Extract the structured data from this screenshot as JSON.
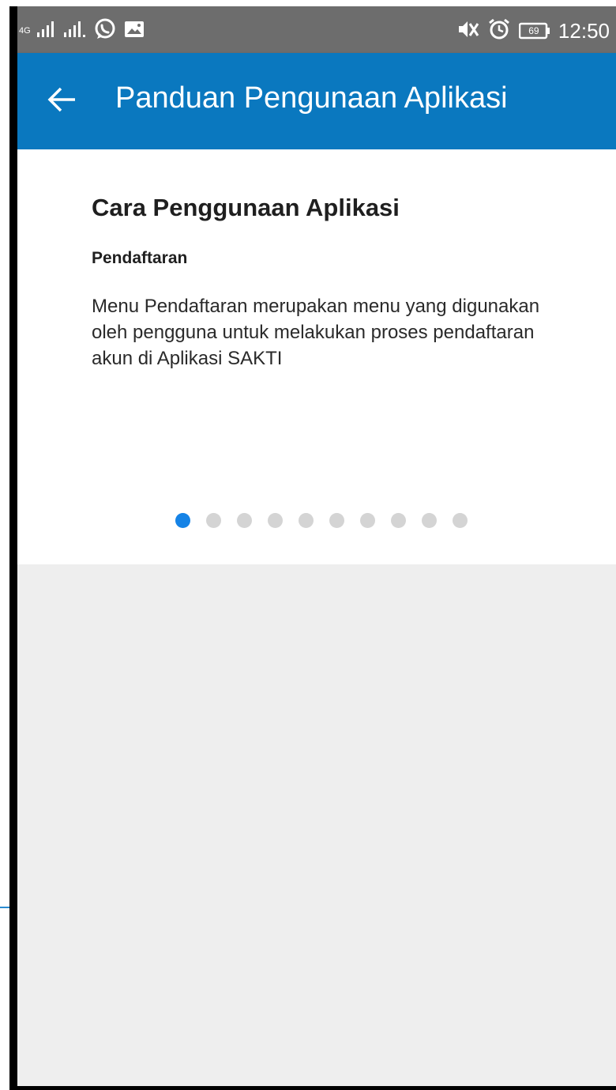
{
  "status_bar": {
    "network_label": "4G",
    "time": "12:50",
    "battery_level": "69",
    "icons": [
      "signal-icon",
      "signal-icon",
      "whatsapp-icon",
      "image-icon",
      "mute-icon",
      "alarm-icon",
      "battery-icon"
    ]
  },
  "app_bar": {
    "back_icon": "arrow-left-icon",
    "title": "Panduan Pengunaan Aplikasi"
  },
  "guide": {
    "title": "Cara Penggunaan Aplikasi",
    "section_heading": "Pendaftaran",
    "section_body": "Menu Pendaftaran merupakan menu yang digunakan oleh pengguna untuk melakukan proses pendaftaran akun di Aplikasi SAKTI"
  },
  "pager": {
    "total_pages": 10,
    "current_page": 1
  },
  "colors": {
    "app_bar": "#0a78bf",
    "status_bar": "#6d6d6d",
    "active_dot": "#1583e6",
    "inactive_dot": "#d4d4d4",
    "background": "#eeeeee"
  }
}
